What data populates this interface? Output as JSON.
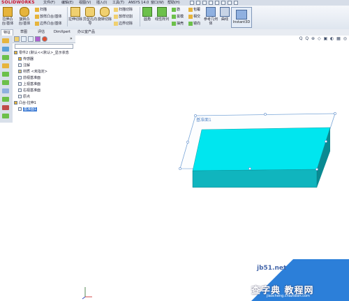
{
  "app": {
    "brand": "SOLIDWORKS",
    "menus": [
      "文件(F)",
      "编辑(E)",
      "视图(V)",
      "插入(I)",
      "工具(T)",
      "ANSYS 14.0",
      "窗口(W)",
      "帮助(H)"
    ]
  },
  "ribbon": {
    "groups": [
      {
        "big": [
          "拉伸凸台/基体",
          "旋转凸台/基体"
        ]
      },
      {
        "small": [
          "扫描",
          "放样凸台/基体",
          "边界凸台/基体"
        ]
      },
      {
        "big": [
          "拉伸切除",
          "异型孔向导",
          "旋转切除"
        ]
      },
      {
        "small": [
          "扫描切除",
          "放样切割",
          "边界切除"
        ]
      },
      {
        "big": [
          "圆角"
        ]
      },
      {
        "big": [
          "线性阵列"
        ]
      },
      {
        "small": [
          "筋",
          "拔模",
          "抽壳"
        ]
      },
      {
        "small": [
          "包覆",
          "相交",
          "镜向"
        ]
      },
      {
        "big": [
          "参考几何体"
        ]
      },
      {
        "big": [
          "曲线"
        ]
      }
    ],
    "instant3d": "Instant3D"
  },
  "tabs": [
    "特征",
    "草图",
    "评估",
    "DimXpert",
    "办公室产品"
  ],
  "active_tab": "特征",
  "feature_tree": {
    "root": "零件2 (默认<<默认>_显示状态",
    "items": [
      "传感器",
      "注解",
      "材质 <未指定>",
      "前视基准面",
      "上视基准面",
      "右视基准面",
      "原点",
      "凸台-拉伸1",
      "基准面1"
    ],
    "selected": "基准面1"
  },
  "viewport": {
    "plane_label": "基准面1",
    "cursor_readout": "",
    "view_tools": "Q Q ⊕ ◇ ▣ ◐ ▦ ◎"
  },
  "watermark": {
    "site": "jb51.net",
    "url": "jiaocheng.chazidian.com",
    "title": "查字典 教程网"
  },
  "colors": {
    "block_top": "#00e6ef",
    "block_front": "#10b5be",
    "block_side": "#0a8a92",
    "plane_stroke": "#7aa6d8",
    "watermark_bg": "#2c7fd9",
    "selection": "#3d7bd4"
  }
}
